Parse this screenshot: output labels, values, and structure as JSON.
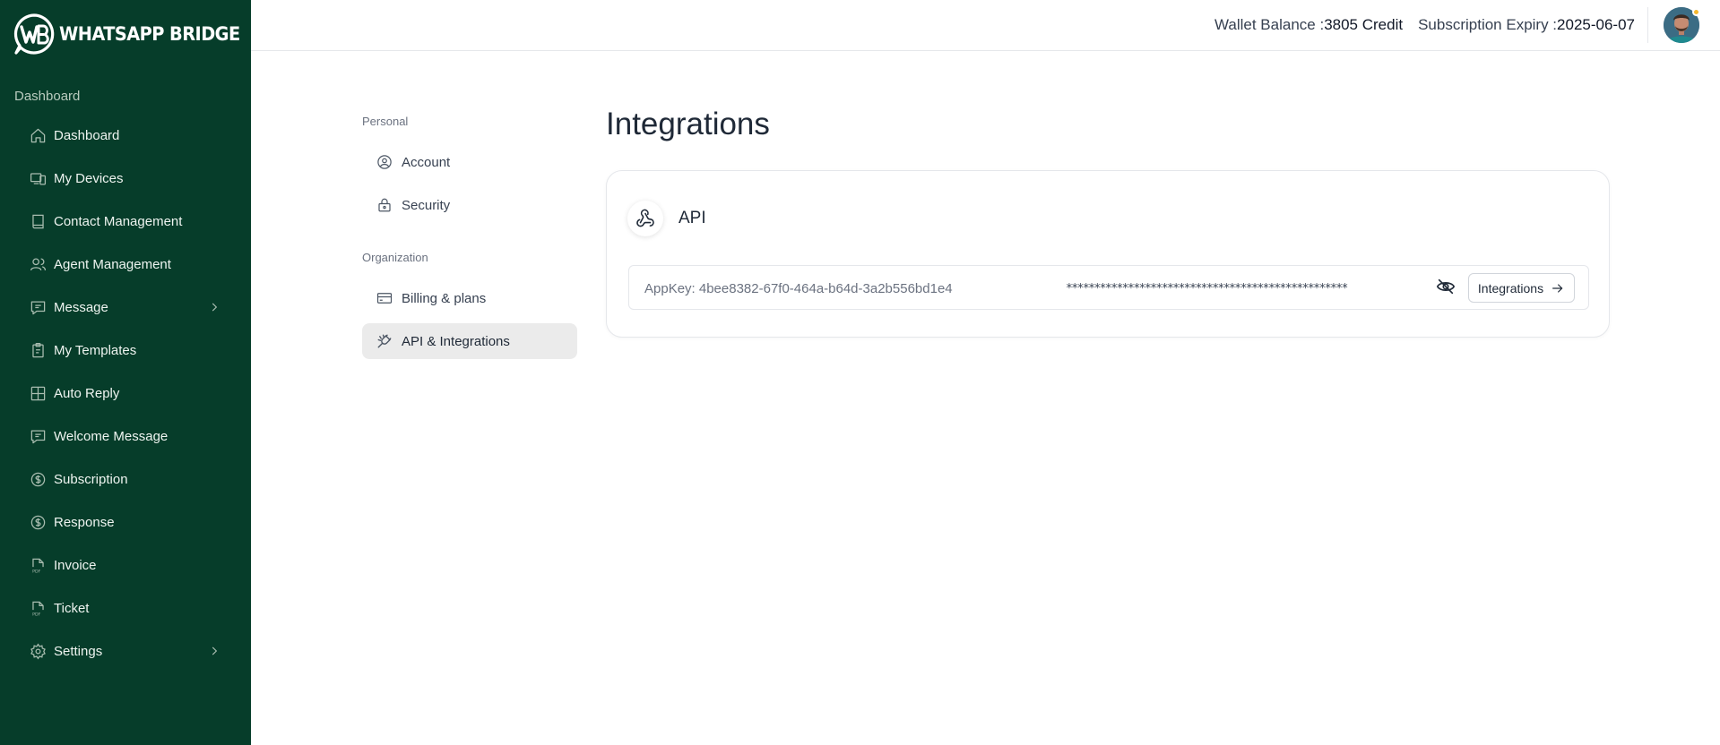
{
  "brand": {
    "name": "WHATSAPP BRIDGE",
    "logo_icon": "wb-logo-icon"
  },
  "sidebar": {
    "section_label": "Dashboard",
    "items": [
      {
        "label": "Dashboard",
        "icon": "home-icon"
      },
      {
        "label": "My Devices",
        "icon": "devices-icon"
      },
      {
        "label": "Contact Management",
        "icon": "book-icon"
      },
      {
        "label": "Agent Management",
        "icon": "users-icon"
      },
      {
        "label": "Message",
        "icon": "message-icon",
        "has_submenu": true
      },
      {
        "label": "My Templates",
        "icon": "clipboard-icon"
      },
      {
        "label": "Auto Reply",
        "icon": "grid-icon"
      },
      {
        "label": "Welcome Message",
        "icon": "message-icon"
      },
      {
        "label": "Subscription",
        "icon": "dollar-icon"
      },
      {
        "label": "Response",
        "icon": "dollar-icon"
      },
      {
        "label": "Invoice",
        "icon": "pdf-icon"
      },
      {
        "label": "Ticket",
        "icon": "pdf-icon"
      },
      {
        "label": "Settings",
        "icon": "gear-icon",
        "has_submenu": true
      }
    ]
  },
  "header": {
    "wallet_label": "Wallet Balance :",
    "wallet_value": "3805 Credit",
    "expiry_label": "Subscription Expiry :",
    "expiry_value": "2025-06-07"
  },
  "settings_nav": {
    "personal_label": "Personal",
    "organization_label": "Organization",
    "account": "Account",
    "security": "Security",
    "billing": "Billing & plans",
    "api": "API & Integrations"
  },
  "main": {
    "title": "Integrations",
    "card": {
      "title": "API",
      "appkey_text": "AppKey: 4bee8382-67f0-464a-b64d-3a2b556bd1e4",
      "masked_value": "**************************************************",
      "button_label": "Integrations"
    }
  },
  "colors": {
    "sidebar_bg": "#063d2a",
    "active_nav_bg": "#ebebeb"
  }
}
